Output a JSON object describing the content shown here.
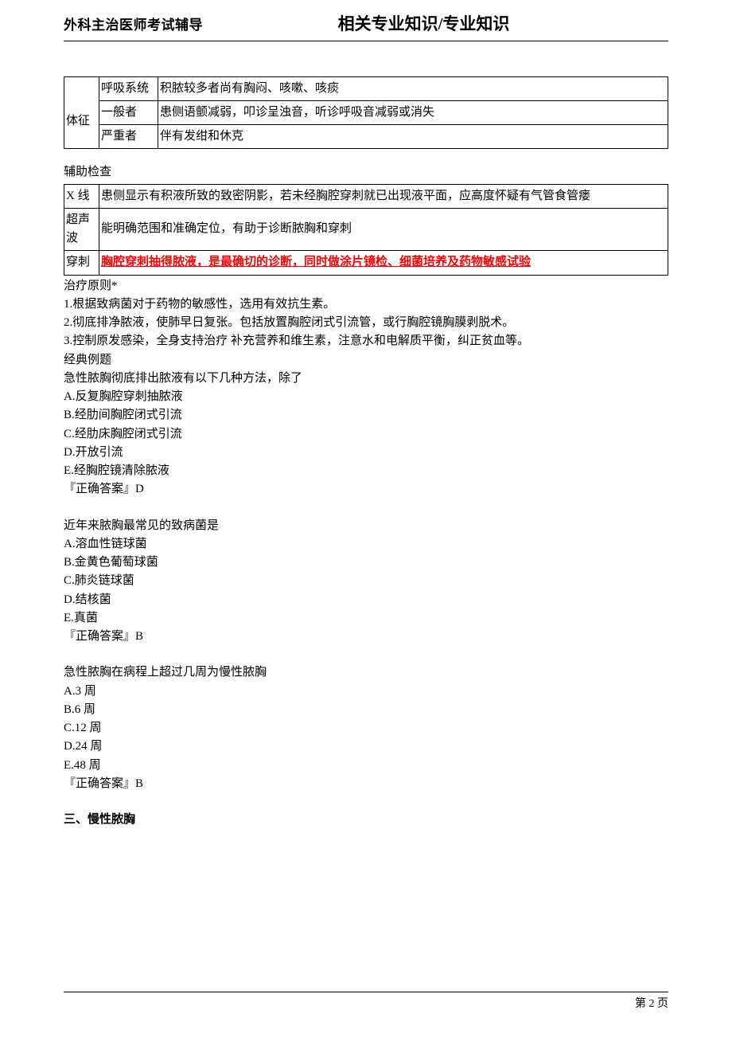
{
  "header": {
    "left": "外科主治医师考试辅导",
    "title": "相关专业知识/专业知识"
  },
  "table1": {
    "rowgroup_label": "体征",
    "r0": {
      "c0": "呼吸系统",
      "c1": "积脓较多者尚有胸闷、咳嗽、咳痰"
    },
    "r1": {
      "c0": "一般者",
      "c1": "患侧语颤减弱，叩诊呈浊音，听诊呼吸音减弱或消失"
    },
    "r2": {
      "c0": "严重者",
      "c1": "伴有发绀和休克"
    }
  },
  "aux_heading": "辅助检查",
  "table2": {
    "r0": {
      "c0": "X 线",
      "c1": "患侧显示有积液所致的致密阴影，若未经胸腔穿刺就已出现液平面，应高度怀疑有气管食管瘘"
    },
    "r1": {
      "c0": "超声波",
      "c1": "能明确范围和准确定位，有助于诊断脓胸和穿刺"
    },
    "r2": {
      "c0": "穿刺",
      "c1": "胸腔穿刺抽得脓液，是最确切的诊断，同时做涂片镜检、细菌培养及药物敏感试验"
    }
  },
  "treatment": {
    "heading": "治疗原则*",
    "p1": "1.根据致病菌对于药物的敏感性，选用有效抗生素。",
    "p2": "2.彻底排净脓液，使肺早日复张。包括放置胸腔闭式引流管，或行胸腔镜胸膜剥脱术。",
    "p3": "3.控制原发感染，全身支持治疗 补充营养和维生素，注意水和电解质平衡，纠正贫血等。"
  },
  "classic_heading": "经典例题",
  "q1": {
    "stem": "急性脓胸彻底排出脓液有以下几种方法，除了",
    "a": "A.反复胸腔穿刺抽脓液",
    "b": "B.经肋间胸腔闭式引流",
    "c": "C.经肋床胸腔闭式引流",
    "d": "D.开放引流",
    "e": "E.经胸腔镜清除脓液",
    "ans": "『正确答案』D"
  },
  "q2": {
    "stem": "近年来脓胸最常见的致病菌是",
    "a": "A.溶血性链球菌",
    "b": "B.金黄色葡萄球菌",
    "c": "C.肺炎链球菌",
    "d": "D.结核菌",
    "e": "E.真菌",
    "ans": "『正确答案』B"
  },
  "q3": {
    "stem": "急性脓胸在病程上超过几周为慢性脓胸",
    "a": "A.3 周",
    "b": "B.6 周",
    "c": "C.12 周",
    "d": "D.24 周",
    "e": "E.48 周",
    "ans": "『正确答案』B"
  },
  "section3": "三、慢性脓胸",
  "footer": {
    "page": "第 2 页"
  }
}
